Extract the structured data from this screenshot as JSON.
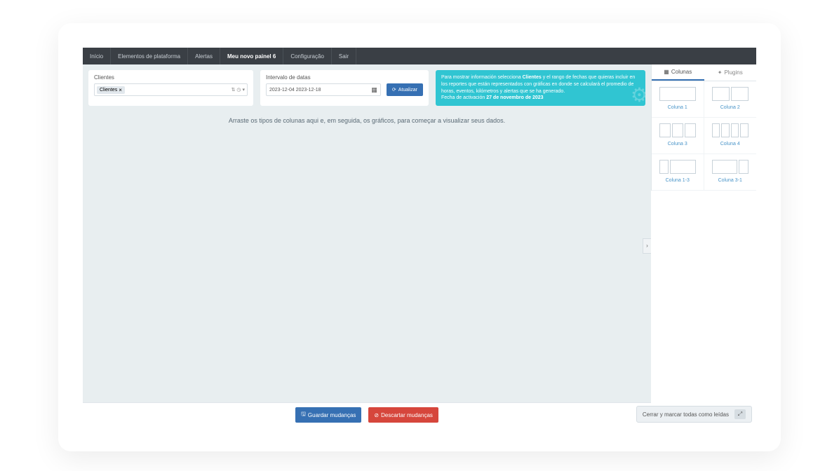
{
  "topbar": {
    "items": [
      {
        "label": "Início"
      },
      {
        "label": "Elementos de plataforma"
      },
      {
        "label": "Alertas"
      },
      {
        "label": "Meu novo painel 6",
        "active": true
      },
      {
        "label": "Configuração"
      },
      {
        "label": "Sair"
      }
    ]
  },
  "filters": {
    "clients": {
      "label": "Clientes",
      "tag": "Clientes",
      "stepper": "⇅",
      "clock": "◷",
      "chevron": "▾"
    },
    "dates": {
      "label": "Intervalo de datas",
      "value": "2023-12-04 2023-12-18"
    },
    "refresh": {
      "label": "Atualizar"
    }
  },
  "info": {
    "pre": "Para mostrar información selecciona ",
    "bold1": "Clientes",
    "mid": " y el rango de fechas que quieras incluir en los reportes que están representados con gráficas en donde se calculará el promedio de horas, eventos, kilómetros y alertas que se ha generado.",
    "activation_label": "Fecha de activación ",
    "activation_date": "27 de novembro de 2023"
  },
  "drop_hint": "Arraste os tipos de colunas aqui e, em seguida, os gráficos, para começar a visualizar seus dados.",
  "footer": {
    "save": "Guardar mudanças",
    "discard": "Descartar mudanças"
  },
  "sidebar": {
    "tabs": {
      "columns": "Colunas",
      "plugins": "Plugins"
    },
    "items": [
      {
        "label": "Coluna 1",
        "cols": [
          1
        ]
      },
      {
        "label": "Coluna 2",
        "cols": [
          1,
          1
        ]
      },
      {
        "label": "Coluna 3",
        "cols": [
          1,
          1,
          1
        ]
      },
      {
        "label": "Coluna 4",
        "cols": [
          1,
          1,
          1,
          1
        ]
      },
      {
        "label": "Coluna 1-3",
        "cols": [
          1,
          3
        ]
      },
      {
        "label": "Coluna 3-1",
        "cols": [
          3,
          1
        ]
      }
    ]
  },
  "toast": {
    "text": "Cerrar y marcar todas como leídas"
  }
}
